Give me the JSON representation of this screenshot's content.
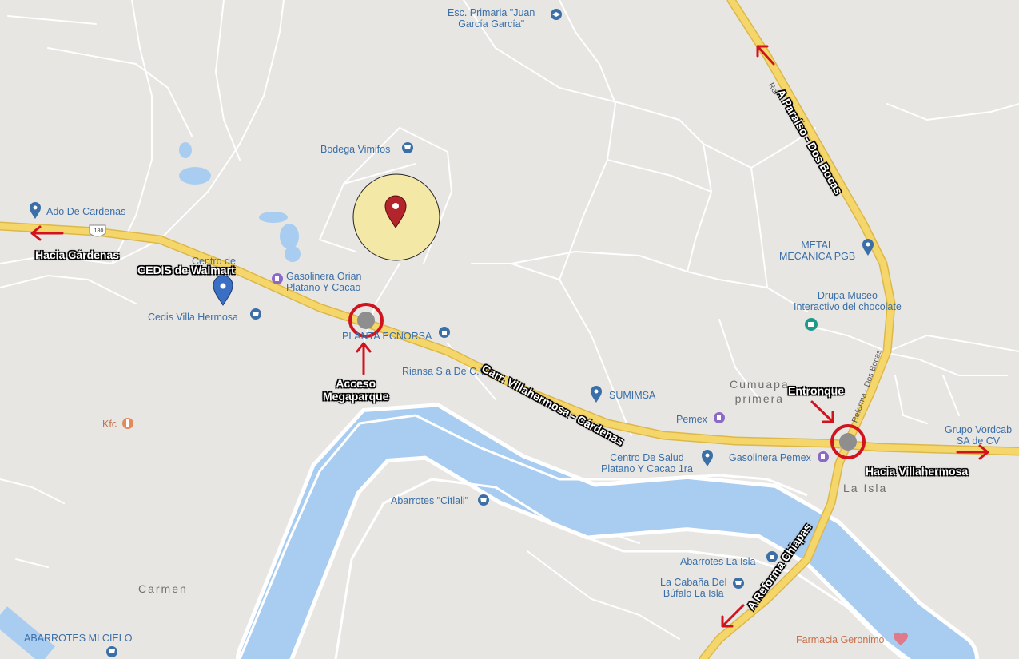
{
  "map": {
    "poi_labels": {
      "esc_primaria": "Esc. Primaria \"Juan\nGarcía García\"",
      "bodega": "Bodega Vimifos",
      "ado": "Ado De Cardenas",
      "centro_de": "Centro de",
      "gasolinera_orian": "Gasolinera Orian\nPlatano Y Cacao",
      "cedis_villa": "Cedis Villa Hermosa",
      "planta": "PLANTA ECNORSA",
      "riansa": "Riansa S.a De C.V",
      "sumimsa": "SUMIMSA",
      "pemex": "Pemex",
      "metal": "METAL\nMECANICA PGB",
      "drupa": "Drupa Museo\nInteractivo del chocolate",
      "centro_salud": "Centro De Salud\nPlatano Y Cacao 1ra",
      "gasolinera_pemex": "Gasolinera Pemex",
      "grupo": "Grupo Vordcab\nSA de CV",
      "kfc": "Kfc",
      "abarrotes_citlali": "Abarrotes \"Citlali\"",
      "abarrotes_isla": "Abarrotes La Isla",
      "cabana": "La Cabaña Del\nBúfalo La Isla",
      "farmacia": "Farmacia Geronimo",
      "abarrotes_cielo": "ABARROTES MI CIELO"
    },
    "area_labels": {
      "cumuapa": "Cumuapa\nprimera",
      "la_isla": "La Isla",
      "carmen": "Carmen"
    },
    "road_labels": {
      "highway_shield": "180",
      "reforma_dos_bocas": "Reforma - Dos Bocas",
      "ref": "Ref"
    },
    "annotations": {
      "hacia_cardenas": "Hacia Cárdenas",
      "cedis_walmart": "CEDIS de Walmart",
      "acceso": "Acceso\nMegaparque",
      "carretera": "Carr. Villahermosa - Cárdenas",
      "entronque": "Entronque",
      "hacia_villahermosa": "Hacia Villahermosa",
      "a_paraiso": "A Paraíso - Dos Bocas",
      "a_reforma": "A Reforma Chiapas"
    },
    "colors": {
      "background": "#e8e6e3",
      "highway": "#f5d66b",
      "highway_edge": "#dcb84a",
      "water": "#a8cdf1",
      "minor_road": "#ffffff",
      "annotation_red": "#d0131c",
      "site_circle": "#f3e8a6",
      "site_pin": "#b3242b",
      "walmart_pin": "#3a6fc4",
      "poi_blue": "#3a6fa8",
      "poi_orange": "#c8714a"
    },
    "icons": [
      "school-icon",
      "shopping-cart-icon",
      "location-pin-icon",
      "gas-station-icon",
      "museum-icon",
      "hospital-icon",
      "restaurant-icon",
      "pharmacy-icon"
    ]
  }
}
